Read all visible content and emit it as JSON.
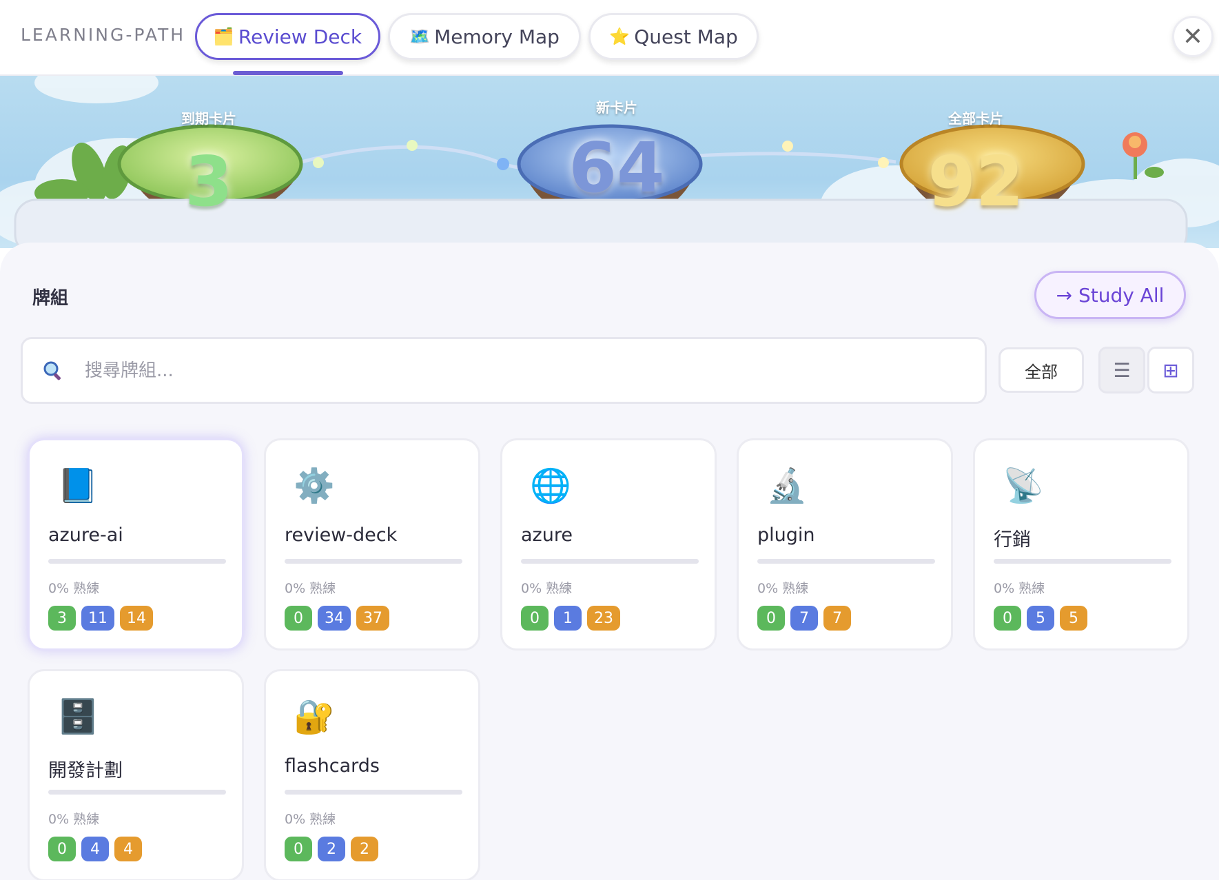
{
  "header": {
    "brand": "LEARNING-PATH",
    "tabs": [
      {
        "label": "Review Deck",
        "icon": "🗂️",
        "active": true
      },
      {
        "label": "Memory Map",
        "icon": "🗺️",
        "active": false
      },
      {
        "label": "Quest Map",
        "icon": "⭐",
        "active": false
      }
    ],
    "close_symbol": "✕"
  },
  "stats": {
    "due": {
      "label": "到期卡片",
      "value": "3"
    },
    "new": {
      "label": "新卡片",
      "value": "64"
    },
    "total": {
      "label": "全部卡片",
      "value": "92"
    }
  },
  "deck_section": {
    "title": "牌組",
    "study_all_label": "→ Study All",
    "search_placeholder": "搜尋牌組...",
    "filter_label": "全部",
    "view_list_symbol": "☰",
    "view_grid_symbol": "⊞"
  },
  "decks": [
    {
      "icon": "📘",
      "icon_name": "book-icon",
      "title": "azure-ai",
      "mastery_text": "0% 熟練",
      "mastery": 0,
      "due": "3",
      "new": "11",
      "total": "14",
      "selected": true
    },
    {
      "icon": "⚙️",
      "icon_name": "gear-icon",
      "title": "review-deck",
      "mastery_text": "0% 熟練",
      "mastery": 0,
      "due": "0",
      "new": "34",
      "total": "37"
    },
    {
      "icon": "🌐",
      "icon_name": "globe-icon",
      "title": "azure",
      "mastery_text": "0% 熟練",
      "mastery": 0,
      "due": "0",
      "new": "1",
      "total": "23"
    },
    {
      "icon": "🔬",
      "icon_name": "microscope-icon",
      "title": "plugin",
      "mastery_text": "0% 熟練",
      "mastery": 0,
      "due": "0",
      "new": "7",
      "total": "7"
    },
    {
      "icon": "📡",
      "icon_name": "satellite-dish-icon",
      "title": "行銷",
      "mastery_text": "0% 熟練",
      "mastery": 0,
      "due": "0",
      "new": "5",
      "total": "5"
    },
    {
      "icon": "🗄️",
      "icon_name": "file-cabinet-icon",
      "title": "開發計劃",
      "mastery_text": "0% 熟練",
      "mastery": 0,
      "due": "0",
      "new": "4",
      "total": "4"
    },
    {
      "icon": "🔐",
      "icon_name": "locked-with-key-icon",
      "title": "flashcards",
      "mastery_text": "0% 熟練",
      "mastery": 0,
      "due": "0",
      "new": "2",
      "total": "2"
    }
  ],
  "colors": {
    "accent": "#6a5ad8",
    "due_badge": "#5cb85c",
    "new_badge": "#5a7be0",
    "total_badge": "#e59b2e"
  }
}
